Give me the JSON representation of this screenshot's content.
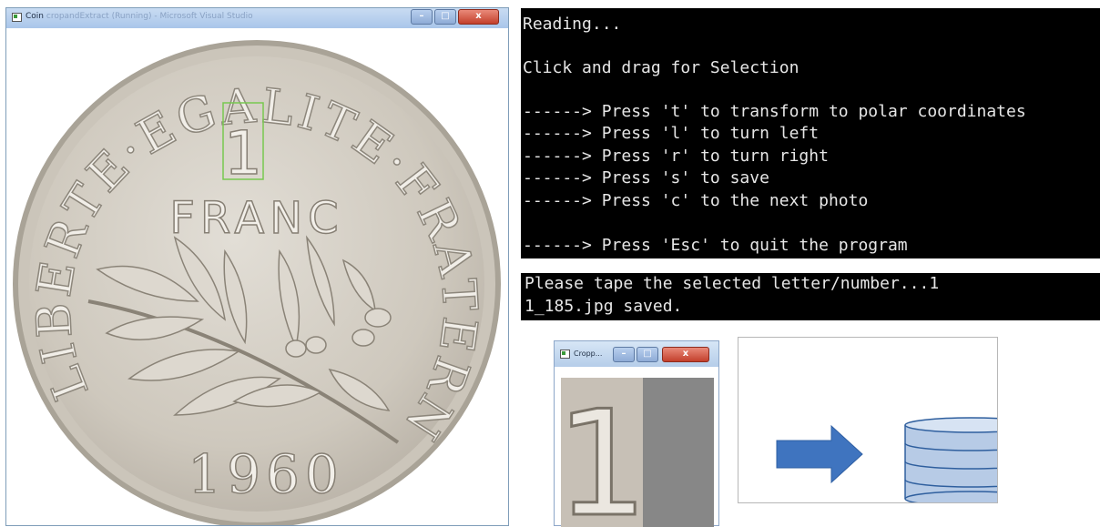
{
  "coin_window": {
    "title": "Coin",
    "title_faded": "cropandExtract (Running) - Microsoft Visual Studio",
    "buttons": [
      "–",
      "□",
      "x"
    ]
  },
  "coin": {
    "arc_text": "LIBERTE·EGALITE·FRATERNITE",
    "denomination": "1",
    "unit": "FRANC",
    "year": "1960",
    "colors": {
      "coin": "#cfc9bf",
      "rim": "#b4aea4",
      "selection_box": "#78c850"
    }
  },
  "console": {
    "lines": [
      "Reading...",
      "",
      "Click and drag for Selection",
      "",
      "------> Press 't' to transform to polar coordinates",
      "------> Press 'l' to turn left",
      "------> Press 'r' to turn right",
      "------> Press 's' to save",
      "------> Press 'c' to the next photo",
      "",
      "------> Press 'Esc' to quit the program"
    ]
  },
  "console_output": {
    "lines": [
      "Please tape the selected letter/number...1",
      "1_185.jpg saved."
    ]
  },
  "crop_window": {
    "title": "Cropp...",
    "buttons": [
      "–",
      "□",
      "x"
    ],
    "crop_text": "1",
    "colors": {
      "gray_panel": "#878787"
    }
  },
  "diagram": {
    "arrow_icon": "right-arrow-icon",
    "database_icon": "database-icon",
    "colors": {
      "arrow": "#3f74bf",
      "db_fill": "#b7cbe6",
      "db_stroke": "#2f5f9e"
    }
  }
}
